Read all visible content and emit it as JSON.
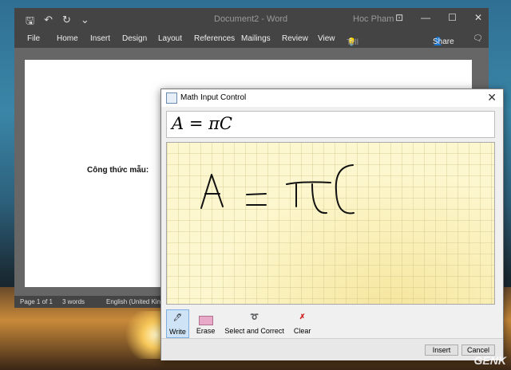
{
  "word": {
    "doc_title": "Document2 - Word",
    "user": "Hoc Pham",
    "ribbon_tabs": [
      "File",
      "Home",
      "Insert",
      "Design",
      "Layout",
      "References",
      "Mailings",
      "Review",
      "View",
      "Tell me"
    ],
    "share_label": "Share",
    "document_text": "Công thức mẫu:",
    "status": {
      "page": "Page 1 of 1",
      "words": "3 words",
      "language": "English (United Kin"
    }
  },
  "dialog": {
    "title": "Math Input Control",
    "preview": "A = πC",
    "tools": [
      "Write",
      "Erase",
      "Select and Correct",
      "Clear"
    ],
    "insert_label": "Insert",
    "cancel_label": "Cancel"
  },
  "watermark": "GENK",
  "colors": {
    "ink_area": "#fdf7cf",
    "titlebar": "#444444",
    "accent": "#7db0e0"
  },
  "icons": [
    "save-icon",
    "undo-icon",
    "redo-icon",
    "lightbulb-icon",
    "user-icon",
    "comment-icon",
    "pen-icon",
    "eraser-icon",
    "lasso-icon",
    "clear-x-icon"
  ]
}
